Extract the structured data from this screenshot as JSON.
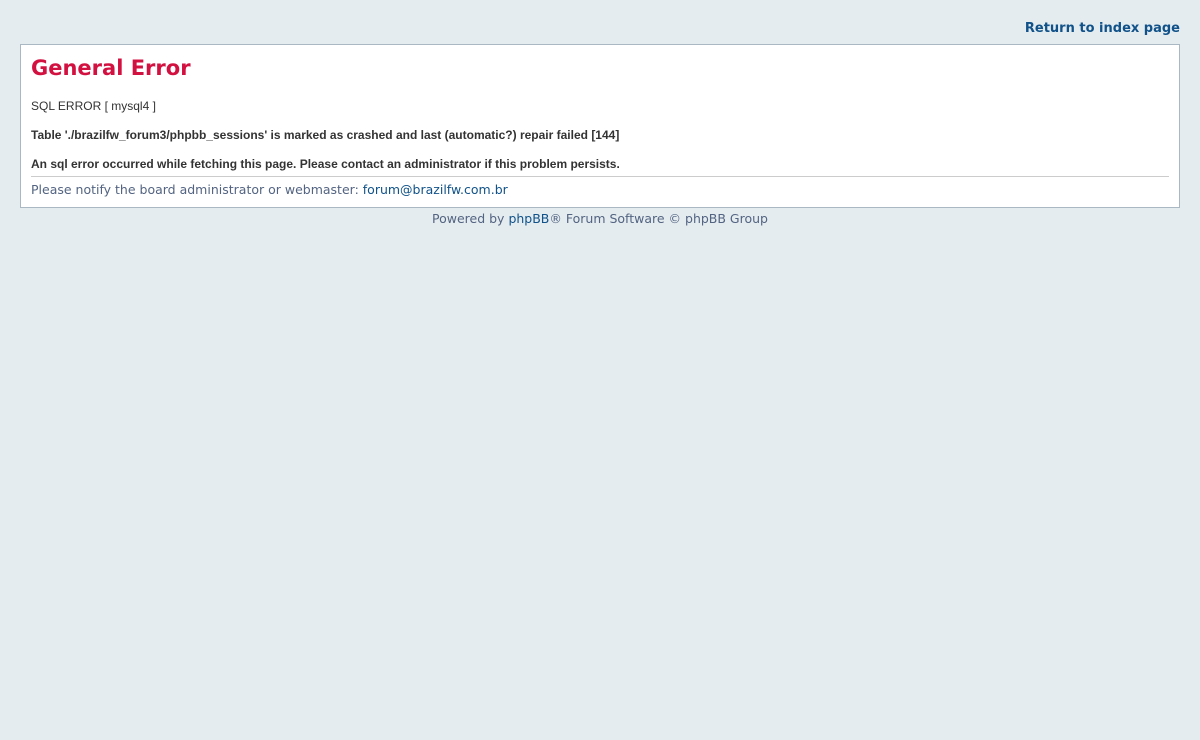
{
  "header": {
    "return_link": "Return to index page"
  },
  "error": {
    "title": "General Error",
    "sql_error": "SQL ERROR [ mysql4 ]",
    "detail": "Table './brazilfw_forum3/phpbb_sessions' is marked as crashed and last (automatic?) repair failed [144]",
    "message": "An sql error occurred while fetching this page. Please contact an administrator if this problem persists.",
    "notify_text": "Please notify the board administrator or webmaster: ",
    "notify_email": "forum@brazilfw.com.br"
  },
  "footer": {
    "prefix": "Powered by ",
    "link": "phpBB",
    "suffix": "® Forum Software © phpBB Group"
  },
  "colors": {
    "background": "#e4ecef",
    "title": "#d31141",
    "link": "#105289"
  }
}
